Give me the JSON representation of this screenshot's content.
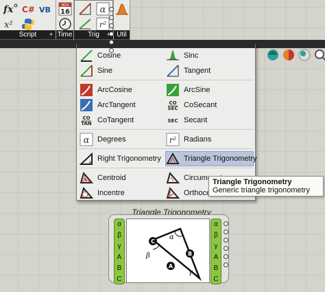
{
  "toolbar": {
    "groups": [
      {
        "label": "Script",
        "plus": "+"
      },
      {
        "label": "Time"
      },
      {
        "label": "Trig",
        "plus": "+"
      },
      {
        "label": "Util"
      }
    ],
    "calendar_day": "16",
    "calendar_month": "NOV",
    "script_icons": [
      {
        "icon": "fx-icon",
        "text": "fx"
      },
      {
        "icon": "csharp-icon",
        "text": "C#"
      },
      {
        "icon": "vb-icon",
        "text": "VB"
      },
      {
        "icon": "expression-x2-icon",
        "text": "x²"
      },
      {
        "icon": "python-icon"
      }
    ]
  },
  "menu": {
    "items": [
      {
        "label": "Cosine",
        "icon": "cosine-icon"
      },
      {
        "label": "Sinc",
        "icon": "sinc-icon"
      },
      {
        "label": "Sine",
        "icon": "sine-icon"
      },
      {
        "label": "Tangent",
        "icon": "tangent-icon"
      },
      {
        "label": "ArcCosine",
        "icon": "arccosine-icon"
      },
      {
        "label": "ArcSine",
        "icon": "arcsine-icon"
      },
      {
        "label": "ArcTangent",
        "icon": "arctangent-icon"
      },
      {
        "label": "CoSecant",
        "icon": "cosecant-icon",
        "glyph": "CO\nSEC"
      },
      {
        "label": "CoTangent",
        "icon": "cotangent-icon",
        "glyph": "CO\nTAN"
      },
      {
        "label": "Secant",
        "icon": "secant-icon",
        "glyph": "SEC"
      },
      {
        "label": "Degrees",
        "icon": "degrees-icon"
      },
      {
        "label": "Radians",
        "icon": "radians-icon"
      },
      {
        "label": "Right Trigonometry",
        "icon": "right-trig-icon"
      },
      {
        "label": "Triangle Trigonometry",
        "icon": "triangle-trig-icon",
        "selected": true
      },
      {
        "label": "Centroid",
        "icon": "centroid-icon"
      },
      {
        "label": "Circumcentre",
        "icon": "circumcentre-icon"
      },
      {
        "label": "Incentre",
        "icon": "incentre-icon"
      },
      {
        "label": "Orthocentre",
        "icon": "orthocentre-icon"
      }
    ]
  },
  "tooltip": {
    "title": "Triangle Trigonometry",
    "description": "Generic triangle trigonometry"
  },
  "component": {
    "title": "Triangle Trigonometry",
    "inputs": [
      "α",
      "β",
      "γ",
      "A",
      "B",
      "C"
    ],
    "outputs": [
      "α",
      "β",
      "γ",
      "A",
      "B",
      "C"
    ],
    "preview_labels": {
      "vertex_a": "A",
      "vertex_b": "B",
      "vertex_c": "C",
      "angle_alpha": "α",
      "angle_beta": "β",
      "angle_gamma": "γ"
    }
  },
  "colors": {
    "menu_bg": "#ededeb",
    "selected_bg": "#b9c6dc",
    "component_green": "#8cc640",
    "toolbar_label_bg": "#1f1f1f",
    "canvas_bg": "#d4d4cc"
  }
}
